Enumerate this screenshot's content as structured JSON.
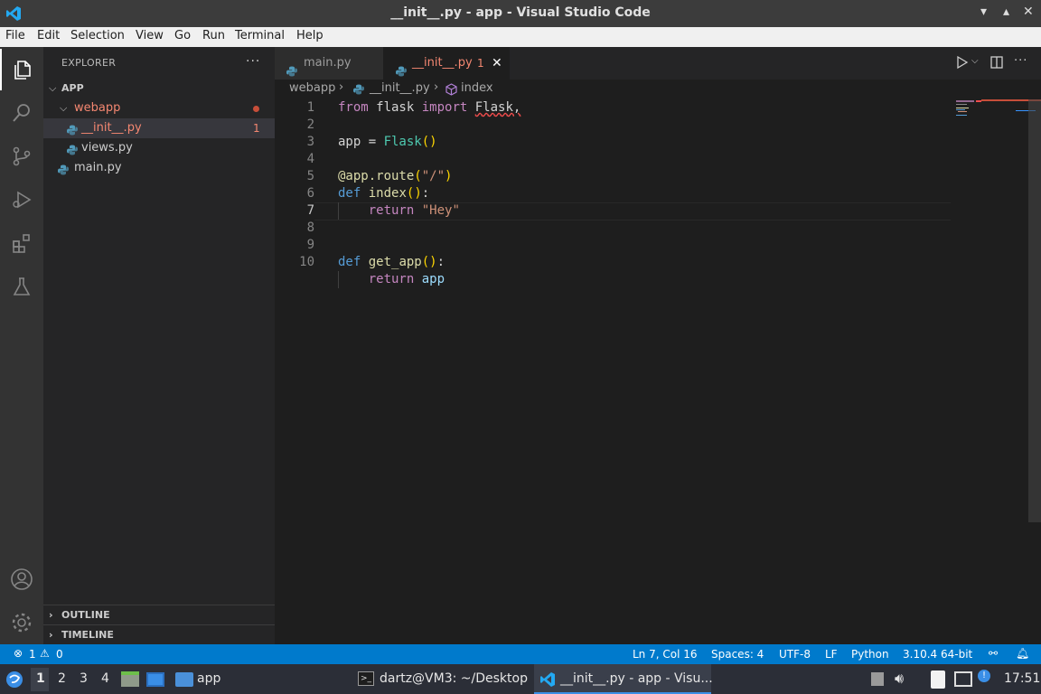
{
  "window": {
    "title": "__init__.py - app - Visual Studio Code"
  },
  "menu": [
    "File",
    "Edit",
    "Selection",
    "View",
    "Go",
    "Run",
    "Terminal",
    "Help"
  ],
  "sidebar": {
    "header": "EXPLORER",
    "root": "APP",
    "folder": "webapp",
    "files": [
      {
        "name": "__init__.py",
        "problems": "1"
      },
      {
        "name": "views.py"
      },
      {
        "name": "main.py"
      }
    ],
    "outline": "OUTLINE",
    "timeline": "TIMELINE"
  },
  "tabs": [
    {
      "name": "main.py"
    },
    {
      "name": "__init__.py",
      "problems": "1"
    }
  ],
  "breadcrumb": {
    "folder": "webapp",
    "file": "__init__.py",
    "symbol": "index"
  },
  "editor": {
    "line_numbers": [
      "1",
      "2",
      "3",
      "4",
      "5",
      "6",
      "7",
      "8",
      "9",
      "10"
    ],
    "current_line": 7
  },
  "status": {
    "errors": "1",
    "warnings": "0",
    "position": "Ln 7, Col 16",
    "spaces": "Spaces: 4",
    "encoding": "UTF-8",
    "eol": "LF",
    "language": "Python",
    "interpreter": "3.10.4 64-bit"
  },
  "taskbar": {
    "workspaces": [
      "1",
      "2",
      "3",
      "4"
    ],
    "folder_app": "app",
    "terminal_task": "dartz@VM3: ~/Desktop",
    "vscode_task": "__init__.py - app - Visu...",
    "clock": "17:51"
  },
  "colors": {
    "accent": "#007acc",
    "error": "#f48771",
    "modified_dot": "#c74e39"
  }
}
